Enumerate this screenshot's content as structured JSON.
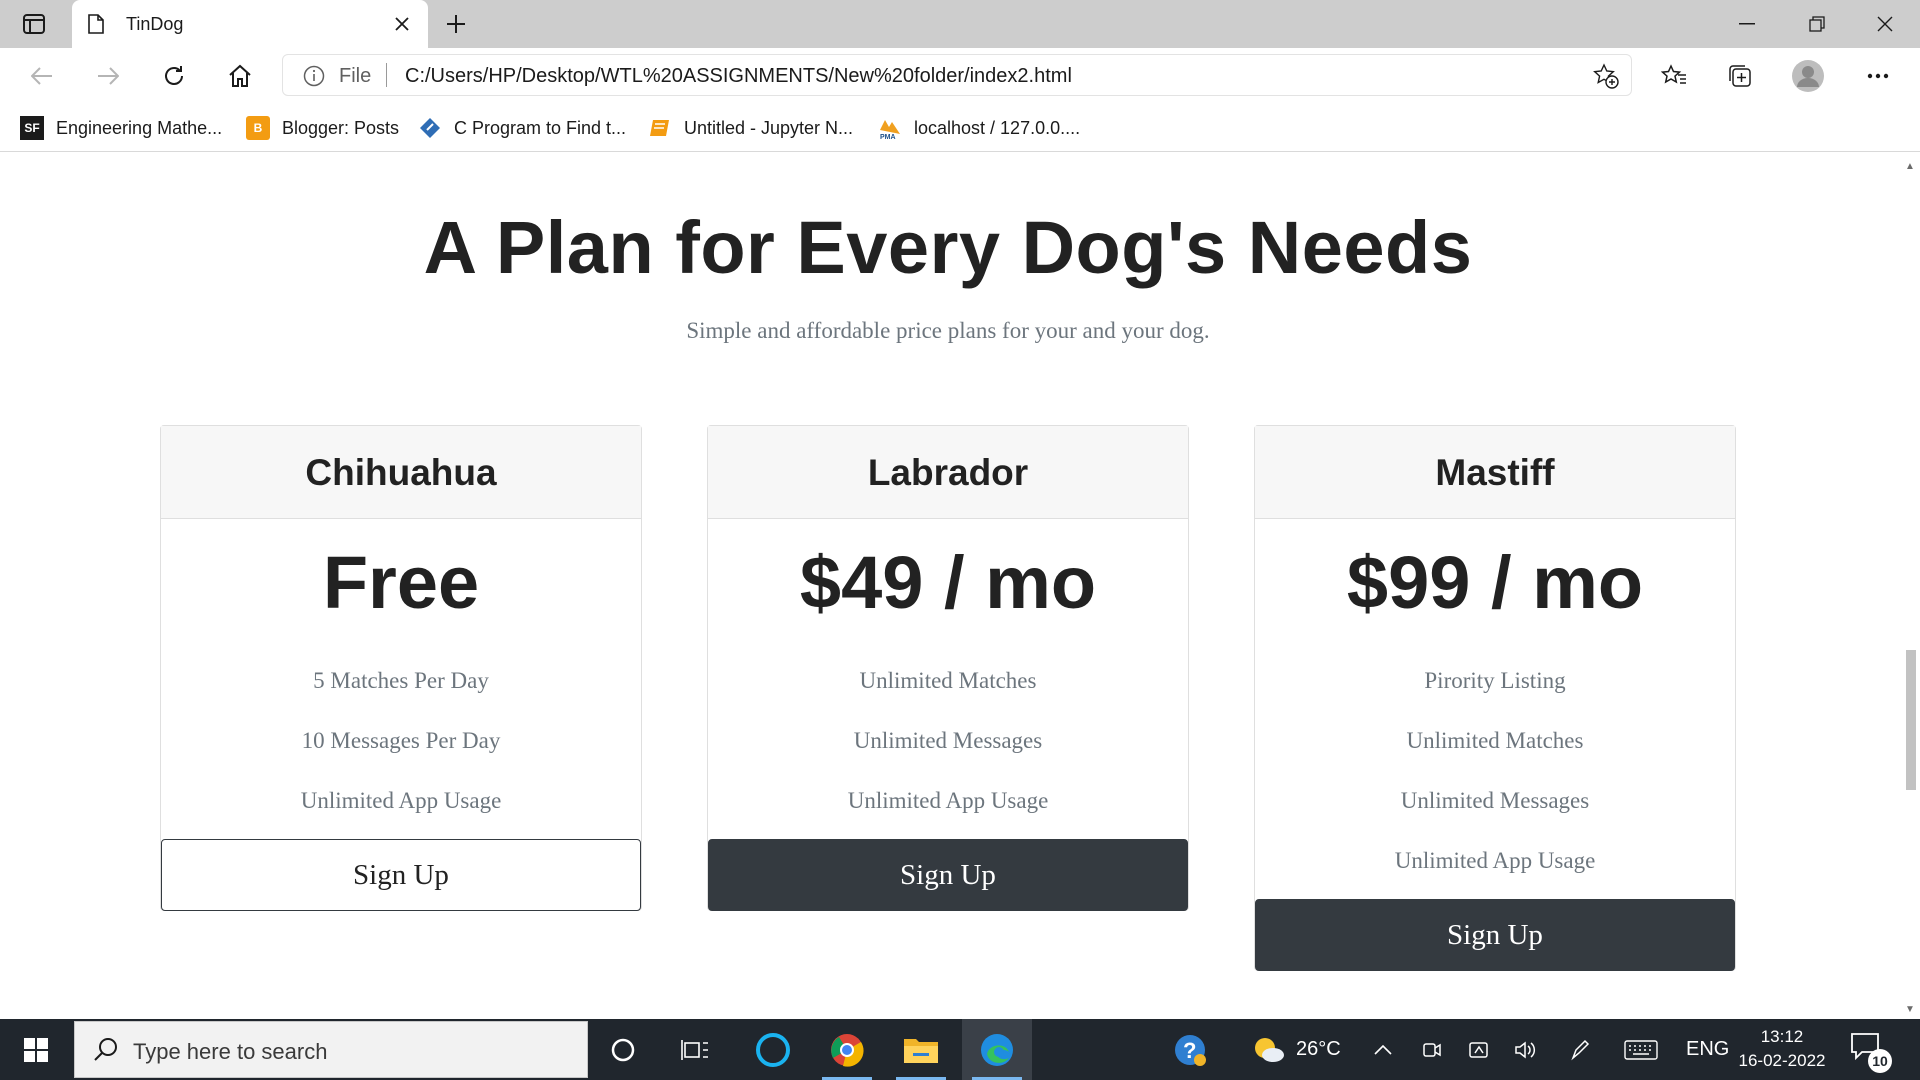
{
  "browser": {
    "tab_title": "TinDog",
    "address_scheme": "File",
    "address_url": "C:/Users/HP/Desktop/WTL%20ASSIGNMENTS/New%20folder/index2.html",
    "bookmarks": [
      {
        "label": "Engineering Mathe...",
        "icon": "SF"
      },
      {
        "label": "Blogger: Posts",
        "icon": "B"
      },
      {
        "label": "C Program to Find t...",
        "icon": ""
      },
      {
        "label": "Untitled - Jupyter N...",
        "icon": ""
      },
      {
        "label": "localhost / 127.0.0....",
        "icon": "PMA"
      }
    ]
  },
  "pricing": {
    "title": "A Plan for Every Dog's Needs",
    "subtitle": "Simple and affordable price plans for your and your dog.",
    "plans": [
      {
        "name": "Chihuahua",
        "price": "Free",
        "features": [
          "5 Matches Per Day",
          "10 Messages Per Day",
          "Unlimited App Usage"
        ],
        "button": "Sign Up"
      },
      {
        "name": "Labrador",
        "price": "$49 / mo",
        "features": [
          "Unlimited Matches",
          "Unlimited Messages",
          "Unlimited App Usage"
        ],
        "button": "Sign Up"
      },
      {
        "name": "Mastiff",
        "price": "$99 / mo",
        "features": [
          "Pirority Listing",
          "Unlimited Matches",
          "Unlimited Messages",
          "Unlimited App Usage"
        ],
        "button": "Sign Up"
      }
    ]
  },
  "taskbar": {
    "search_placeholder": "Type here to search",
    "weather": "26°C",
    "language": "ENG",
    "time": "13:12",
    "date": "16-02-2022",
    "notification_count": "10"
  },
  "colors": {
    "dark_button": "#343a40",
    "muted_text": "#6c757d",
    "card_header_bg": "#f7f7f7",
    "taskbar_bg": "#20262d"
  }
}
